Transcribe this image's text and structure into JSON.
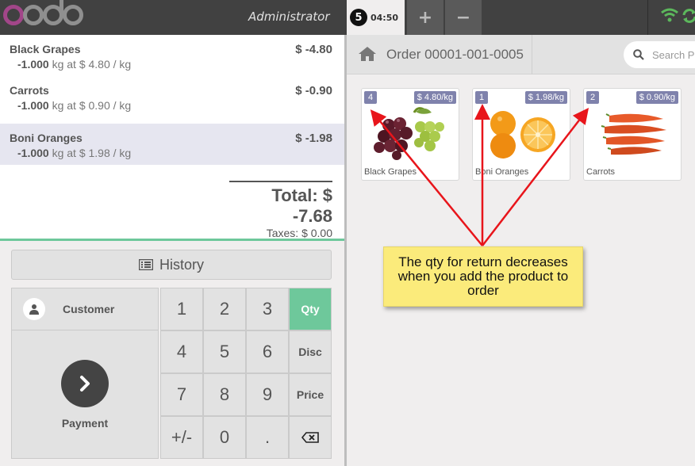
{
  "topbar": {
    "user": "Administrator",
    "order_tab": {
      "sequence": "5",
      "time": "04:50"
    },
    "add_label": "+",
    "remove_label": "−"
  },
  "order": {
    "lines": [
      {
        "product": "Black Grapes",
        "price": "$ -4.80",
        "qty": "-1.000",
        "unit_info": "kg at $ 4.80 / kg",
        "selected": false
      },
      {
        "product": "Carrots",
        "price": "$ -0.90",
        "qty": "-1.000",
        "unit_info": "kg at $ 0.90 / kg",
        "selected": false
      },
      {
        "product": "Boni Oranges",
        "price": "$ -1.98",
        "qty": "-1.000",
        "unit_info": "kg at $ 1.98 / kg",
        "selected": true
      }
    ],
    "total": "Total: $ -7.68",
    "taxes": "Taxes: $ 0.00"
  },
  "actionpad": {
    "history_label": "History",
    "customer_label": "Customer",
    "payment_label": "Payment"
  },
  "numpad": {
    "keys": [
      "1",
      "2",
      "3",
      "Qty",
      "4",
      "5",
      "6",
      "Disc",
      "7",
      "8",
      "9",
      "Price",
      "+/-",
      "0",
      "."
    ],
    "active_mode": "Qty"
  },
  "products_screen": {
    "breadcrumb": "Order 00001-001-0005",
    "search_placeholder": "Search Pr",
    "products": [
      {
        "name": "Black Grapes",
        "return_qty": "4",
        "price": "$ 4.80/kg"
      },
      {
        "name": "Boni Oranges",
        "return_qty": "1",
        "price": "$ 1.98/kg"
      },
      {
        "name": "Carrots",
        "return_qty": "2",
        "price": "$ 0.90/kg"
      }
    ]
  },
  "annotation": {
    "text": "The qty for return decreases when you add the product to order"
  },
  "colors": {
    "accent": "#6ec89b",
    "brand": "#a24689",
    "badge": "#7f82ac",
    "note": "#fbeb7b",
    "arrow": "#e8151b"
  },
  "icons": [
    "history-icon",
    "user-icon",
    "chevron-right-icon",
    "backspace-icon",
    "home-icon",
    "search-icon",
    "wifi-icon",
    "sync-icon"
  ]
}
